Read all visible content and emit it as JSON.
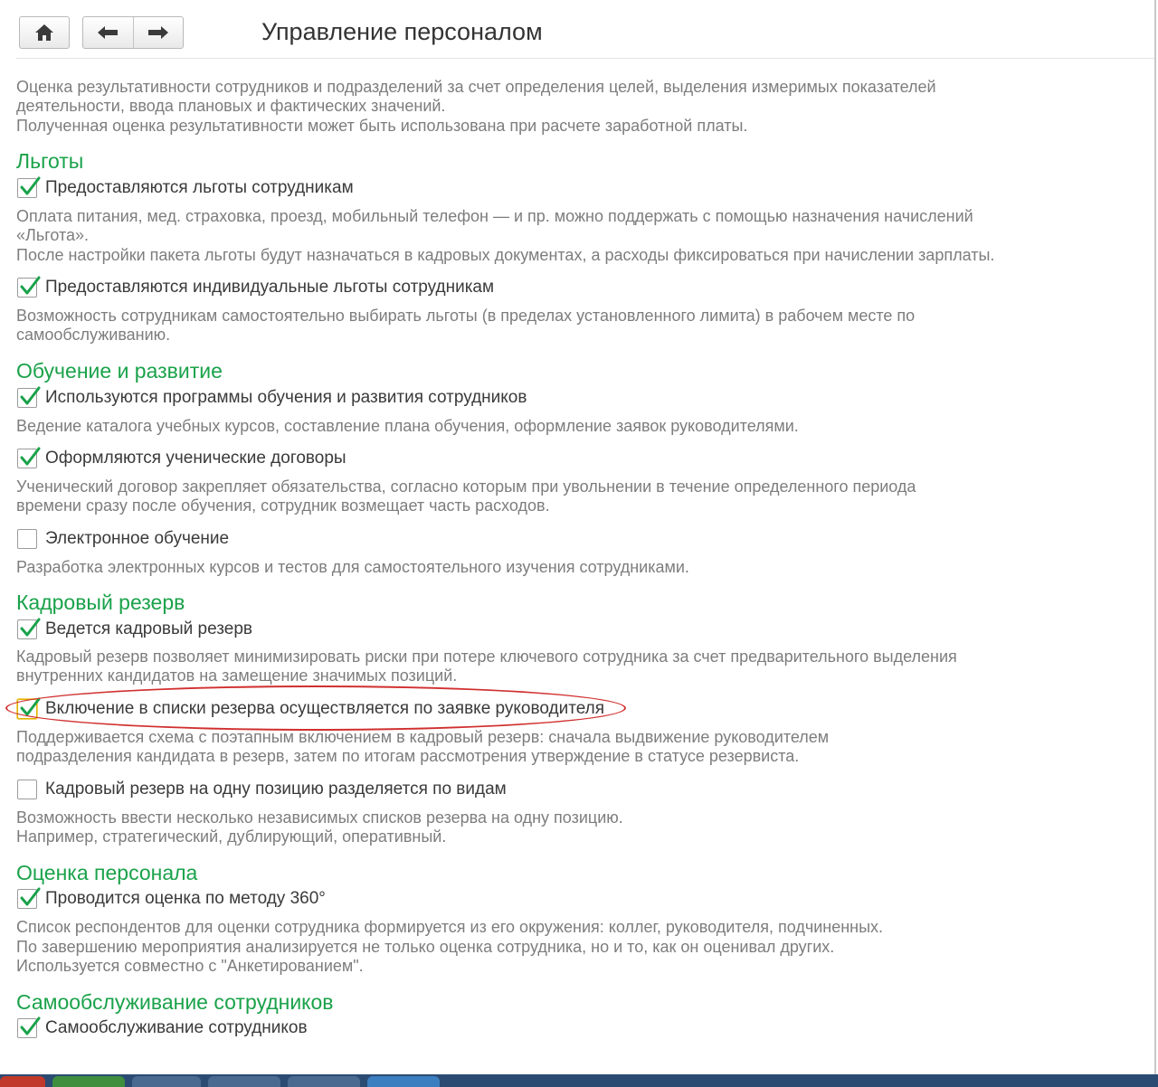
{
  "window": {
    "title": "Управление персоналом"
  },
  "nav": {
    "home_icon": "home-icon",
    "back_icon": "arrow-left-icon",
    "forward_icon": "arrow-right-icon"
  },
  "intro": {
    "line1": "Оценка результативности сотрудников и подразделений за счет определения целей,  выделения измеримых показателей",
    "line2": "деятельности, ввода плановых и фактических значений.",
    "line3": "Полученная оценка результативности может быть использована при расчете заработной платы."
  },
  "sections": {
    "benefits": {
      "title": "Льготы",
      "opt1": {
        "label": "Предоставляются льготы сотрудникам",
        "checked": true,
        "desc1": "Оплата питания, мед. страховка, проезд, мобильный телефон — и пр. можно поддержать с помощью назначения начислений",
        "desc2": "«Льгота».",
        "desc3": "После настройки пакета льготы будут назначаться в кадровых документах, а расходы фиксироваться при начислении зарплаты."
      },
      "opt2": {
        "label": "Предоставляются индивидуальные льготы сотрудникам",
        "checked": true,
        "desc1": "Возможность сотрудникам самостоятельно выбирать льготы (в пределах  установленного лимита) в рабочем месте по",
        "desc2": "самообслуживанию."
      }
    },
    "training": {
      "title": "Обучение и развитие",
      "opt1": {
        "label": "Используются программы обучения и развития сотрудников",
        "checked": true,
        "desc1": "Ведение каталога учебных курсов, составление плана обучения, оформление заявок руководителями."
      },
      "opt2": {
        "label": "Оформляются ученические договоры",
        "checked": true,
        "desc1": "Ученический договор закрепляет обязательства, согласно которым при увольнении в течение определенного периода",
        "desc2": "времени сразу после обучения, сотрудник возмещает часть расходов."
      },
      "opt3": {
        "label": "Электронное обучение",
        "checked": false,
        "desc1": "Разработка электронных курсов и тестов для самостоятельного изучения сотрудниками."
      }
    },
    "reserve": {
      "title": "Кадровый резерв",
      "opt1": {
        "label": "Ведется кадровый резерв",
        "checked": true,
        "desc1": "Кадровый резерв позволяет минимизировать риски при потере ключевого сотрудника за счет предварительного выделения",
        "desc2": "внутренних кандидатов на замещение значимых позиций."
      },
      "opt2": {
        "label": "Включение в списки резерва осуществляется по заявке руководителя",
        "checked": true,
        "desc1": "Поддерживается схема с поэтапным включением в кадровый резерв: сначала выдвижение руководителем",
        "desc2": "подразделения кандидата в резерв, затем по итогам рассмотрения утверждение в статусе резервиста."
      },
      "opt3": {
        "label": "Кадровый резерв на одну позицию разделяется по видам",
        "checked": false,
        "desc1": "Возможность ввести несколько независимых списков резерва на одну позицию.",
        "desc2": "Например, стратегический, дублирующий, оперативный."
      }
    },
    "assessment": {
      "title": "Оценка персонала",
      "opt1": {
        "label": "Проводится оценка по методу 360°",
        "checked": true,
        "desc1": "Список респондентов для оценки сотрудника формируется из его окружения: коллег, руководителя, подчиненных.",
        "desc2": "По завершению мероприятия анализируется не только оценка сотрудника, но и то, как он оценивал других.",
        "desc3": "Используется совместно с \"Анкетированием\"."
      }
    },
    "selfservice": {
      "title": "Самообслуживание сотрудников",
      "opt1": {
        "label": "Самообслуживание сотрудников",
        "checked": true
      }
    }
  },
  "colors": {
    "section_title": "#1aa24a",
    "check": "#1aa24a",
    "highlight": "#d0302f"
  }
}
